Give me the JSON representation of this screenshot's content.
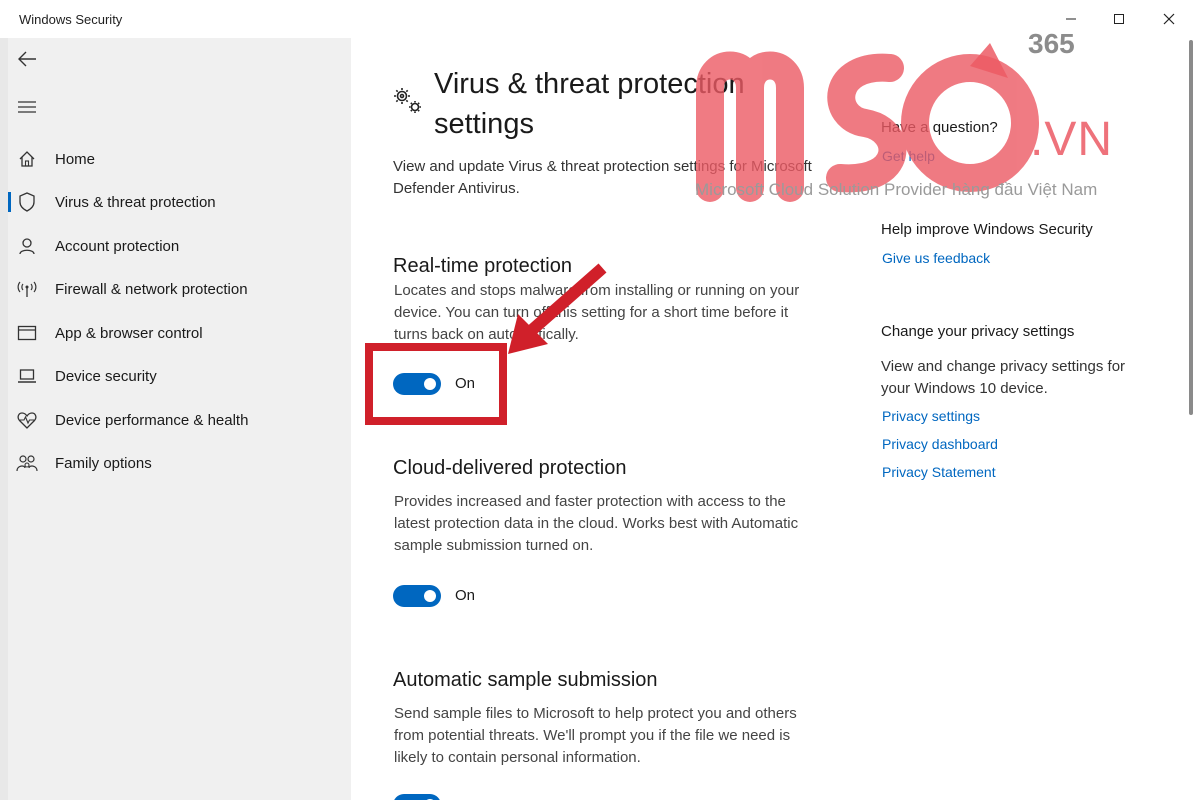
{
  "window": {
    "title": "Windows Security",
    "controls": {
      "minimize": "—",
      "maximize": "☐",
      "close": "✕"
    }
  },
  "sidebar": {
    "items": [
      {
        "label": "Home",
        "icon": "home-icon",
        "active": false
      },
      {
        "label": "Virus & threat protection",
        "icon": "shield-icon",
        "active": true
      },
      {
        "label": "Account protection",
        "icon": "person-icon",
        "active": false
      },
      {
        "label": "Firewall & network protection",
        "icon": "antenna-icon",
        "active": false
      },
      {
        "label": "App & browser control",
        "icon": "browser-window-icon",
        "active": false
      },
      {
        "label": "Device security",
        "icon": "laptop-icon",
        "active": false
      },
      {
        "label": "Device performance & health",
        "icon": "heart-pulse-icon",
        "active": false
      },
      {
        "label": "Family options",
        "icon": "family-icon",
        "active": false
      }
    ]
  },
  "main": {
    "title_line1": "Virus & threat protection",
    "title_line2": "settings",
    "description": "View and update Virus & threat protection settings for Microsoft Defender Antivirus.",
    "sections": [
      {
        "title": "Real-time protection",
        "description": "Locates and stops malware from installing or running on your device. You can turn off this setting for a short time before it turns back on automatically.",
        "toggle": true,
        "toggle_label": "On"
      },
      {
        "title": "Cloud-delivered protection",
        "description": "Provides increased and faster protection with access to the latest protection data in the cloud. Works best with Automatic sample submission turned on.",
        "toggle": true,
        "toggle_label": "On"
      },
      {
        "title": "Automatic sample submission",
        "description": "Send sample files to Microsoft to help protect you and others from potential threats. We'll prompt you if the file we need is likely to contain personal information."
      }
    ]
  },
  "right": {
    "question_heading": "Have a question?",
    "get_help": "Get help",
    "improve_heading": "Help improve Windows Security",
    "feedback": "Give us feedback",
    "privacy_heading": "Change your privacy settings",
    "privacy_text": "View and change privacy settings for your Windows 10 device.",
    "links": [
      "Privacy settings",
      "Privacy dashboard",
      "Privacy Statement"
    ]
  },
  "watermark": {
    "brand": "MSO",
    "suffix_365": "365",
    "domain": ".VN",
    "tagline": "Microsoft Cloud Solution Provider hàng đầu Việt Nam"
  },
  "colors": {
    "accent": "#0067c0",
    "highlight": "#d0202a",
    "watermark": "#ec5a64",
    "sidebar_bg": "#f0f0f0"
  }
}
